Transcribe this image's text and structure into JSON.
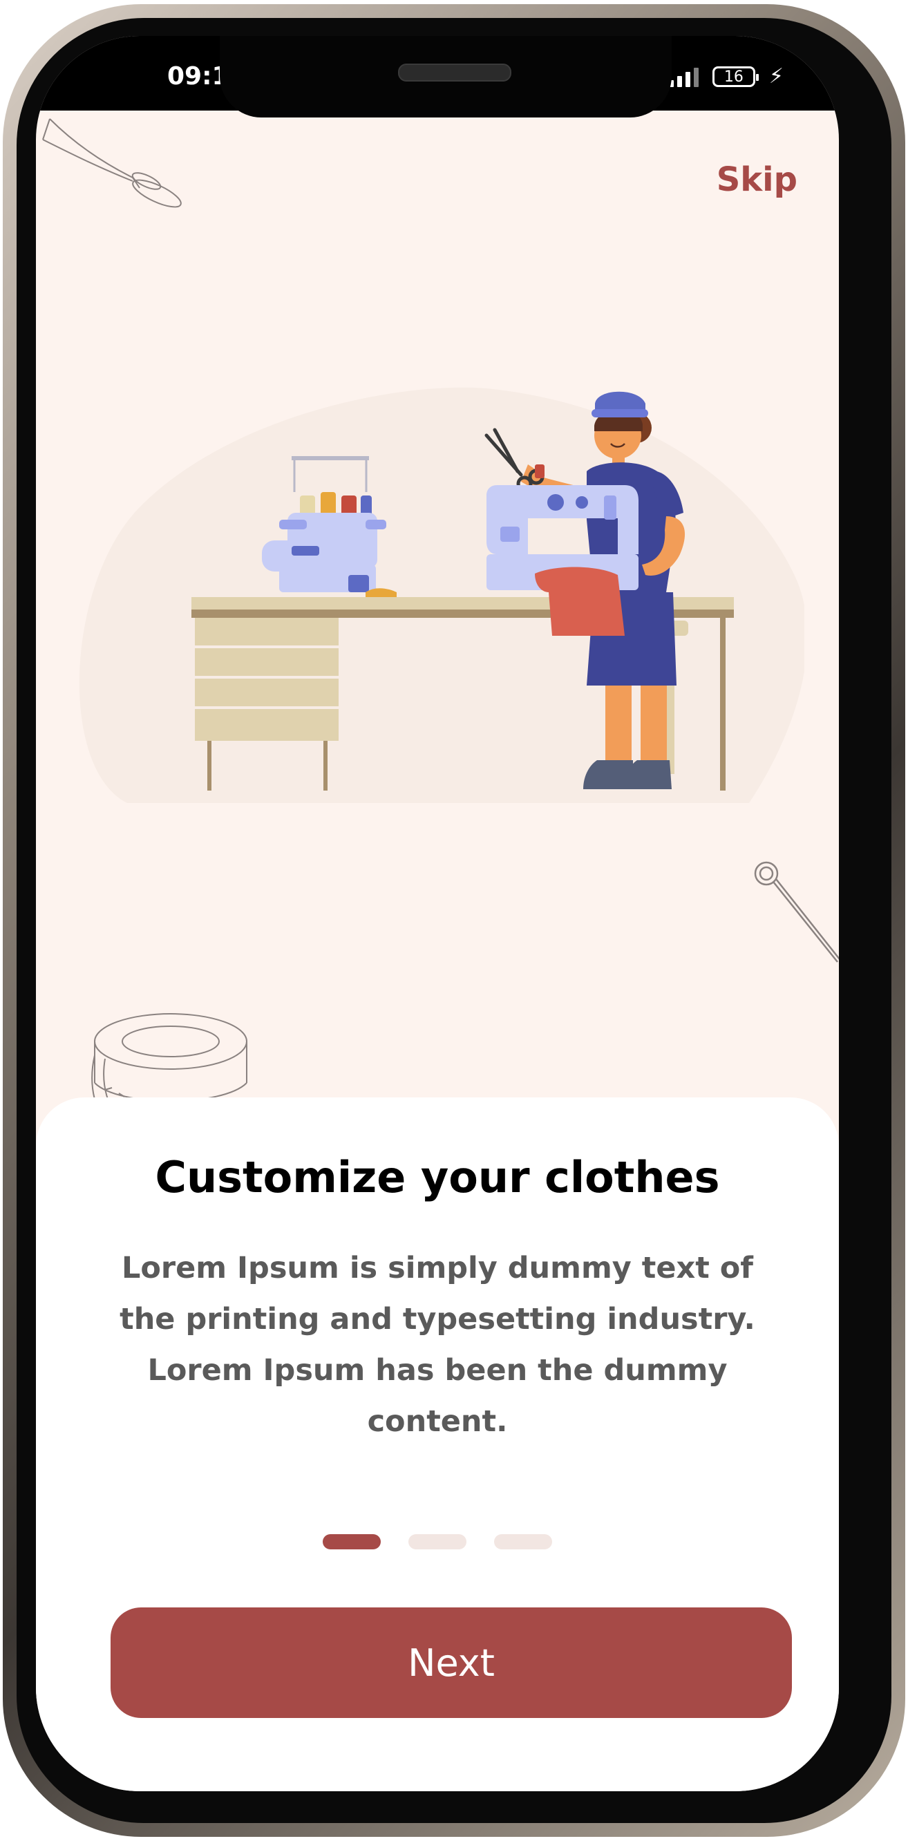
{
  "status_bar": {
    "time": "09:1",
    "battery": "16"
  },
  "header": {
    "skip_label": "Skip"
  },
  "onboarding": {
    "title": "Customize your clothes",
    "description": "Lorem Ipsum is simply dummy text of the printing and typesetting industry. Lorem Ipsum has been the dummy content.",
    "pagination": {
      "total": 3,
      "active_index": 0
    }
  },
  "footer": {
    "next_label": "Next"
  },
  "colors": {
    "accent": "#a64a47",
    "background": "#fdf3ee",
    "card": "#ffffff",
    "inactive_dot": "#f2e6e2"
  },
  "icons": {
    "scissors": "scissors-icon",
    "pin": "pin-icon",
    "measuring_tape": "measuring-tape-icon",
    "signal": "signal-icon",
    "battery": "battery-icon",
    "charging": "charging-bolt-icon"
  }
}
